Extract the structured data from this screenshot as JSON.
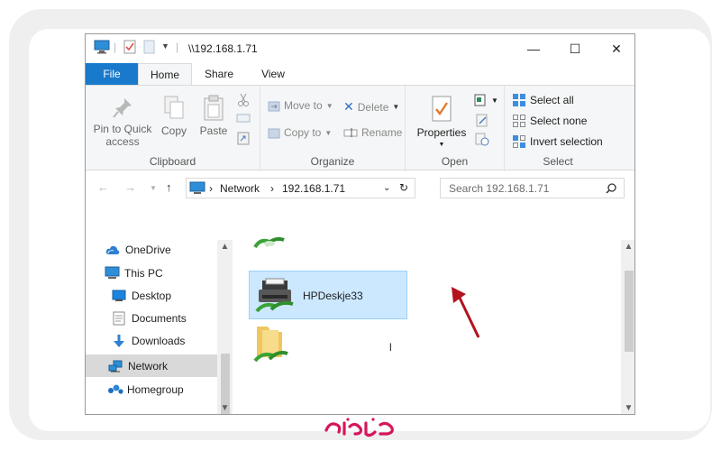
{
  "window": {
    "title": "\\\\192.168.1.71",
    "controls": {
      "minimize": "—",
      "maximize": "☐",
      "close": "✕"
    }
  },
  "tabs": {
    "file": "File",
    "home": "Home",
    "share": "Share",
    "view": "View"
  },
  "ribbon": {
    "clipboard": {
      "label": "Clipboard",
      "pin_line1": "Pin to Quick",
      "pin_line2": "access",
      "copy": "Copy",
      "paste": "Paste"
    },
    "organize": {
      "label": "Organize",
      "move_to": "Move to",
      "copy_to": "Copy to",
      "delete": "Delete",
      "rename": "Rename"
    },
    "open": {
      "label": "Open",
      "properties": "Properties"
    },
    "select": {
      "label": "Select",
      "select_all": "Select all",
      "select_none": "Select none",
      "invert": "Invert selection"
    }
  },
  "address": {
    "crumbs": [
      "Network",
      "192.168.1.71"
    ],
    "search_placeholder": "Search 192.168.1.71"
  },
  "nav": {
    "items": [
      {
        "label": "OneDrive",
        "icon": "cloud-icon"
      },
      {
        "label": "This PC",
        "icon": "computer-icon"
      },
      {
        "label": "Desktop",
        "icon": "desktop-icon"
      },
      {
        "label": "Documents",
        "icon": "documents-icon"
      },
      {
        "label": "Downloads",
        "icon": "downloads-icon"
      },
      {
        "label": "Network",
        "icon": "network-icon"
      },
      {
        "label": "Homegroup",
        "icon": "homegroup-icon"
      }
    ]
  },
  "content": {
    "items": [
      {
        "label": "HPDeskje33",
        "icon": "printer-icon"
      },
      {
        "label": "l",
        "icon": "shared-folder-icon"
      }
    ]
  },
  "colors": {
    "accent": "#1979ca",
    "selection": "#cce8ff",
    "arrow": "#b3121f"
  }
}
